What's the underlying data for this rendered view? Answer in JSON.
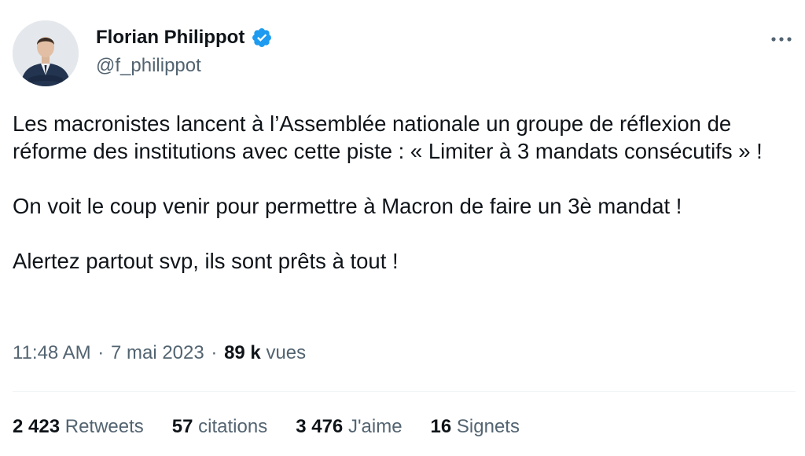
{
  "author": {
    "name": "Florian Philippot",
    "handle": "@f_philippot",
    "verified": true,
    "verified_color": "#1d9bf0"
  },
  "tweet": {
    "paragraphs": [
      "Les macronistes lancent à l’Assemblée nationale un groupe de réflexion de réforme des institutions avec cette piste : « Limiter à 3 mandats consécutifs » !",
      "On voit le coup venir pour permettre à Macron de faire un 3è mandat !",
      "Alertez partout svp, ils sont prêts à tout !"
    ]
  },
  "meta": {
    "time": "11:48 AM",
    "separator": "·",
    "date": "7 mai 2023",
    "views_count": "89 k",
    "views_label": "vues"
  },
  "stats": {
    "retweets": {
      "count": "2 423",
      "label": "Retweets"
    },
    "quotes": {
      "count": "57",
      "label": "citations"
    },
    "likes": {
      "count": "3 476",
      "label": "J'aime"
    },
    "bookmarks": {
      "count": "16",
      "label": "Signets"
    }
  },
  "icons": {
    "verified": "verified-badge-icon",
    "more": "more-dots-icon"
  },
  "colors": {
    "text": "#0f1419",
    "secondary": "#536471",
    "divider": "#eff3f4"
  }
}
